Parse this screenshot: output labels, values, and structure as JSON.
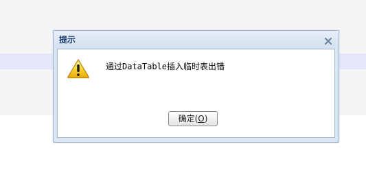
{
  "dialog": {
    "title": "提示",
    "message": "通过DataTable插入临时表出错",
    "icon": "warning-icon",
    "close_icon": "close-icon",
    "ok_button": {
      "label": "确定(",
      "mnemonic": "O",
      "suffix": ")"
    }
  },
  "colors": {
    "title_text": "#1c3f6e",
    "dialog_frame": "#dbe6f3",
    "dialog_border": "#9db3cf",
    "warning_yellow": "#f6c21a",
    "row_highlight": "#e4e6fb"
  }
}
